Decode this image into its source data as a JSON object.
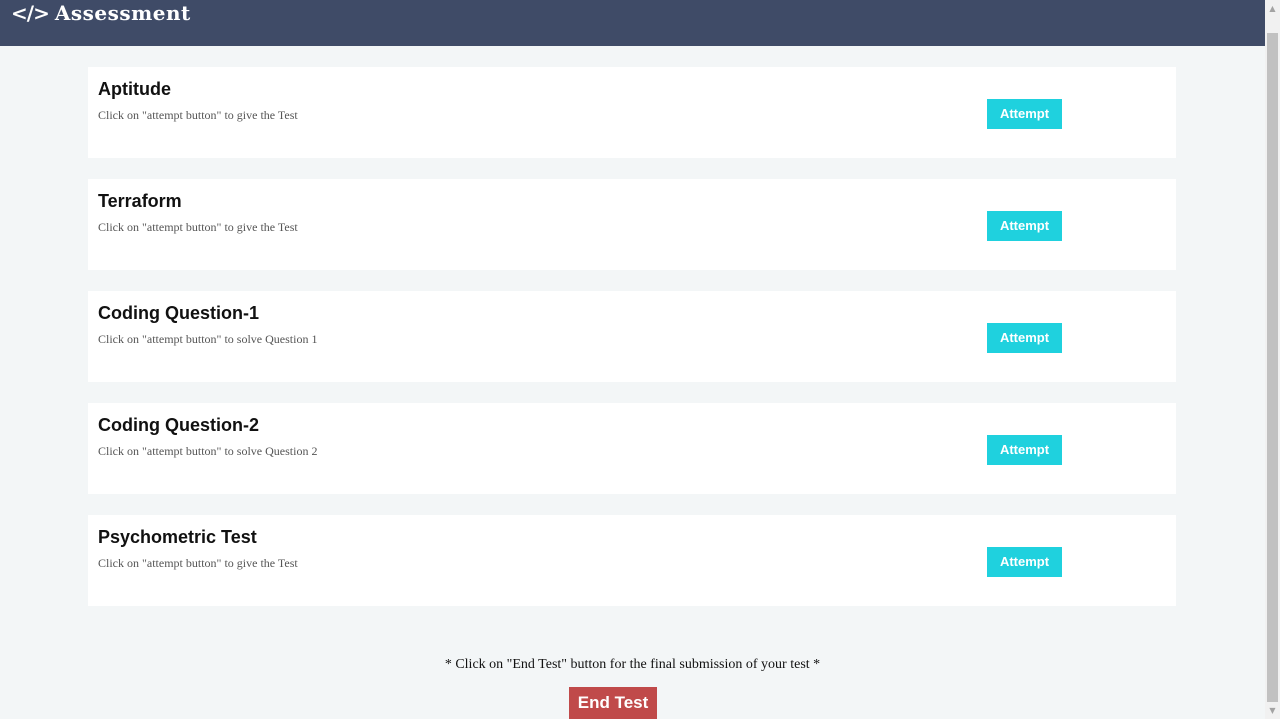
{
  "header": {
    "icon": "code-icon",
    "icon_glyph": "</>",
    "title": "Assessment"
  },
  "assessments": [
    {
      "title": "Aptitude",
      "description": "Click on \"attempt button\" to give the Test",
      "button_label": "Attempt"
    },
    {
      "title": "Terraform",
      "description": "Click on \"attempt button\" to give the Test",
      "button_label": "Attempt"
    },
    {
      "title": "Coding Question-1",
      "description": "Click on \"attempt button\" to solve Question 1",
      "button_label": "Attempt"
    },
    {
      "title": "Coding Question-2",
      "description": "Click on \"attempt button\" to solve Question 2",
      "button_label": "Attempt"
    },
    {
      "title": "Psychometric Test",
      "description": "Click on \"attempt button\" to give the Test",
      "button_label": "Attempt"
    }
  ],
  "footer": {
    "note": "* Click on \"End Test\" button for the final submission of your test *",
    "end_button_label": "End Test"
  },
  "scrollbar": {
    "up_icon": "arrow-up-icon",
    "down_icon": "arrow-down-icon"
  },
  "colors": {
    "header_bg": "#3f4b67",
    "page_bg": "#f3f6f7",
    "attempt_button": "#1fd1de",
    "end_button": "#c04a4a"
  }
}
